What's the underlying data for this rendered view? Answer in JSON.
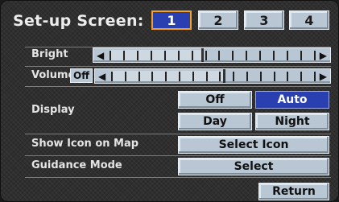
{
  "screen": {
    "title": "Set-up Screen:",
    "pages": [
      "1",
      "2",
      "3",
      "4"
    ],
    "selected_page": "1"
  },
  "bright": {
    "label": "Bright",
    "level_fraction": 0.45
  },
  "volume": {
    "label": "Volume",
    "off_label": "Off",
    "level_fraction": 0.55
  },
  "display": {
    "label": "Display",
    "options": {
      "off": "Off",
      "auto": "Auto",
      "day": "Day",
      "night": "Night"
    },
    "selected": "Auto"
  },
  "show_icon": {
    "label": "Show Icon on Map",
    "button": "Select Icon"
  },
  "guidance": {
    "label": "Guidance Mode",
    "button": "Select"
  },
  "return_label": "Return",
  "colors": {
    "selected_blue": "#2a3fb0",
    "selected_outline": "#f2a21e",
    "button_gray": "#b9c7d4"
  }
}
